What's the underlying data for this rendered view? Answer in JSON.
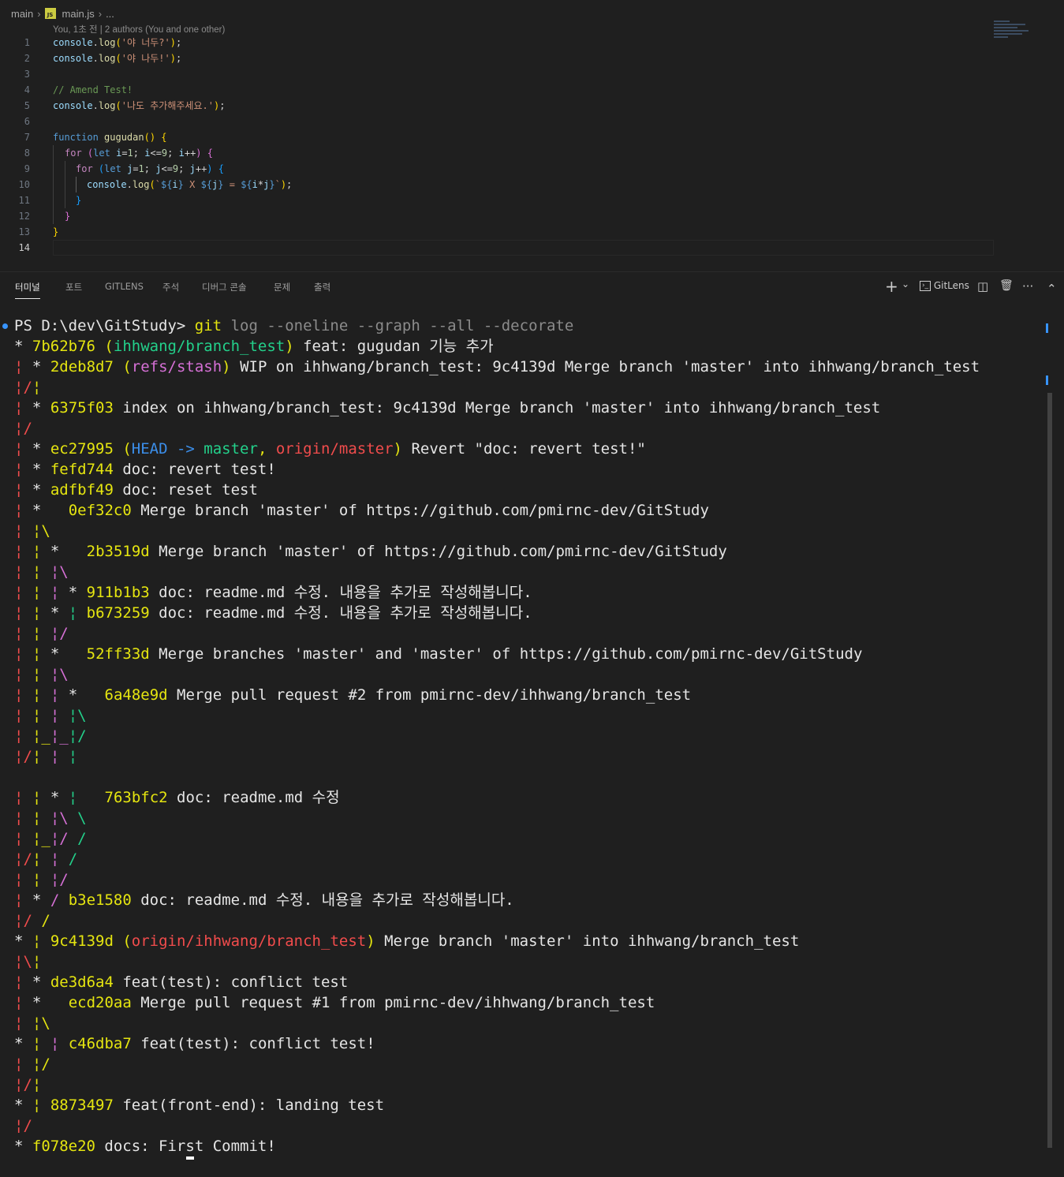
{
  "breadcrumb": {
    "folder": "main",
    "file": "main.js",
    "tail": "..."
  },
  "blame": "You, 1초 전 | 2 authors (You and one other)",
  "panel": {
    "tabs": [
      "터미널",
      "포트",
      "GITLENS",
      "주석",
      "디버그 콘솔",
      "문제",
      "출력"
    ],
    "active_tab": "터미널",
    "actions": {
      "add": "+",
      "add_menu": "⌄",
      "gitlens": "GitLens",
      "split": "◫",
      "trash": "🗑",
      "more": "···",
      "collapse": "⌃"
    }
  },
  "code_lines": [
    {
      "n": "1"
    },
    {
      "n": "2"
    },
    {
      "n": "3"
    },
    {
      "n": "4"
    },
    {
      "n": "5"
    },
    {
      "n": "6"
    },
    {
      "n": "7"
    },
    {
      "n": "8"
    },
    {
      "n": "9"
    },
    {
      "n": "10"
    },
    {
      "n": "11"
    },
    {
      "n": "12"
    },
    {
      "n": "13"
    },
    {
      "n": "14"
    }
  ],
  "code": {
    "l1_str": "'야 너두?'",
    "l2_str": "'야 나두!'",
    "l4_comment": "// Amend Test!",
    "l5_str": "'나도 추가해주세요.'",
    "l7_fn": "gugudan",
    "console": "console",
    "log": "log",
    "function": "function",
    "for": "for",
    "let": "let"
  },
  "terminal": {
    "prompt": "PS D:\\dev\\GitStudy>",
    "command": "git",
    "command_rest": "log --oneline --graph --all --decorate",
    "lines": [
      {
        "graph": "* ",
        "hash": "7b62b76",
        "ref_open": " (",
        "refs": [
          {
            "t": "ihhwang/branch_test",
            "c": "g"
          }
        ],
        "ref_close": ")",
        "msg": " feat: gugudan 기능 추가"
      },
      {
        "graph": "¦ * ",
        "hash": "2deb8d7",
        "ref_open": " (",
        "refs": [
          {
            "t": "refs/stash",
            "c": "m"
          }
        ],
        "ref_close": ")",
        "msg": " WIP on ihhwang/branch_test: 9c4139d Merge branch 'master' into ihhwang/branch_test"
      },
      {
        "graph": "¦/¦",
        "hash": "",
        "msg": ""
      },
      {
        "graph": "¦ * ",
        "hash": "6375f03",
        "msg": " index on ihhwang/branch_test: 9c4139d Merge branch 'master' into ihhwang/branch_test"
      },
      {
        "graph": "¦/",
        "hash": "",
        "msg": ""
      },
      {
        "graph": "¦ * ",
        "hash": "ec27995",
        "ref_open": " (",
        "refs": [
          {
            "t": "HEAD -> ",
            "c": "bb"
          },
          {
            "t": "master",
            "c": "g"
          },
          {
            "t": ", ",
            "c": "y"
          },
          {
            "t": "origin/master",
            "c": "r"
          }
        ],
        "ref_close": ")",
        "msg": " Revert \"doc: revert test!\""
      },
      {
        "graph": "¦ * ",
        "hash": "fefd744",
        "msg": " doc: revert test!"
      },
      {
        "graph": "¦ * ",
        "hash": "adfbf49",
        "msg": " doc: reset test"
      },
      {
        "graph": "¦ *   ",
        "hash": "0ef32c0",
        "msg": " Merge branch 'master' of https://github.com/pmirnc-dev/GitStudy"
      },
      {
        "graph": "¦ ¦\\",
        "hash": "",
        "msg": ""
      },
      {
        "graph": "¦ ¦ *   ",
        "hash": "2b3519d",
        "msg": " Merge branch 'master' of https://github.com/pmirnc-dev/GitStudy"
      },
      {
        "graph": "¦ ¦ ¦\\",
        "hash": "",
        "msg": ""
      },
      {
        "graph": "¦ ¦ ¦ * ",
        "hash": "911b1b3",
        "msg": " doc: readme.md 수정. 내용을 추가로 작성해봅니다."
      },
      {
        "graph": "¦ ¦ * ¦ ",
        "hash": "b673259",
        "msg": " doc: readme.md 수정. 내용을 추가로 작성해봅니다."
      },
      {
        "graph": "¦ ¦ ¦/",
        "hash": "",
        "msg": ""
      },
      {
        "graph": "¦ ¦ *   ",
        "hash": "52ff33d",
        "msg": " Merge branches 'master' and 'master' of https://github.com/pmirnc-dev/GitStudy"
      },
      {
        "graph": "¦ ¦ ¦\\",
        "hash": "",
        "msg": ""
      },
      {
        "graph": "¦ ¦ ¦ *   ",
        "hash": "6a48e9d",
        "msg": " Merge pull request #2 from pmirnc-dev/ihhwang/branch_test"
      },
      {
        "graph": "¦ ¦ ¦ ¦\\",
        "hash": "",
        "msg": ""
      },
      {
        "graph": "¦ ¦_¦_¦/",
        "hash": "",
        "msg": ""
      },
      {
        "graph": "¦/¦ ¦ ¦",
        "hash": "",
        "msg": ""
      },
      {
        "graph": "",
        "hash": "",
        "msg": ""
      },
      {
        "graph": "¦ ¦ * ¦   ",
        "hash": "763bfc2",
        "msg": " doc: readme.md 수정"
      },
      {
        "graph": "¦ ¦ ¦\\ \\",
        "hash": "",
        "msg": ""
      },
      {
        "graph": "¦ ¦_¦/ /",
        "hash": "",
        "msg": ""
      },
      {
        "graph": "¦/¦ ¦ /",
        "hash": "",
        "msg": ""
      },
      {
        "graph": "¦ ¦ ¦/",
        "hash": "",
        "msg": ""
      },
      {
        "graph": "¦ * / ",
        "hash": "b3e1580",
        "msg": " doc: readme.md 수정. 내용을 추가로 작성해봅니다."
      },
      {
        "graph": "¦/ /",
        "hash": "",
        "msg": ""
      },
      {
        "graph": "* ¦ ",
        "hash": "9c4139d",
        "ref_open": " (",
        "refs": [
          {
            "t": "origin/ihhwang/branch_test",
            "c": "r"
          }
        ],
        "ref_close": ")",
        "msg": " Merge branch 'master' into ihhwang/branch_test"
      },
      {
        "graph": "¦\\¦",
        "hash": "",
        "msg": ""
      },
      {
        "graph": "¦ * ",
        "hash": "de3d6a4",
        "msg": " feat(test): conflict test"
      },
      {
        "graph": "¦ *   ",
        "hash": "ecd20aa",
        "msg": " Merge pull request #1 from pmirnc-dev/ihhwang/branch_test"
      },
      {
        "graph": "¦ ¦\\",
        "hash": "",
        "msg": ""
      },
      {
        "graph": "* ¦ ¦ ",
        "hash": "c46dba7",
        "msg": " feat(test): conflict test!"
      },
      {
        "graph": "¦ ¦/",
        "hash": "",
        "msg": ""
      },
      {
        "graph": "¦/¦",
        "hash": "",
        "msg": ""
      },
      {
        "graph": "* ¦ ",
        "hash": "8873497",
        "msg": " feat(front-end): landing test"
      },
      {
        "graph": "¦/",
        "hash": "",
        "msg": ""
      },
      {
        "graph": "* ",
        "hash": "f078e20",
        "msg": " docs: First Commit!"
      }
    ]
  },
  "colors": {
    "accent": "#3794ff",
    "hash": "#e5e510",
    "branch": "#23d18b",
    "remote": "#f14c4c",
    "stash": "#d670d6"
  }
}
